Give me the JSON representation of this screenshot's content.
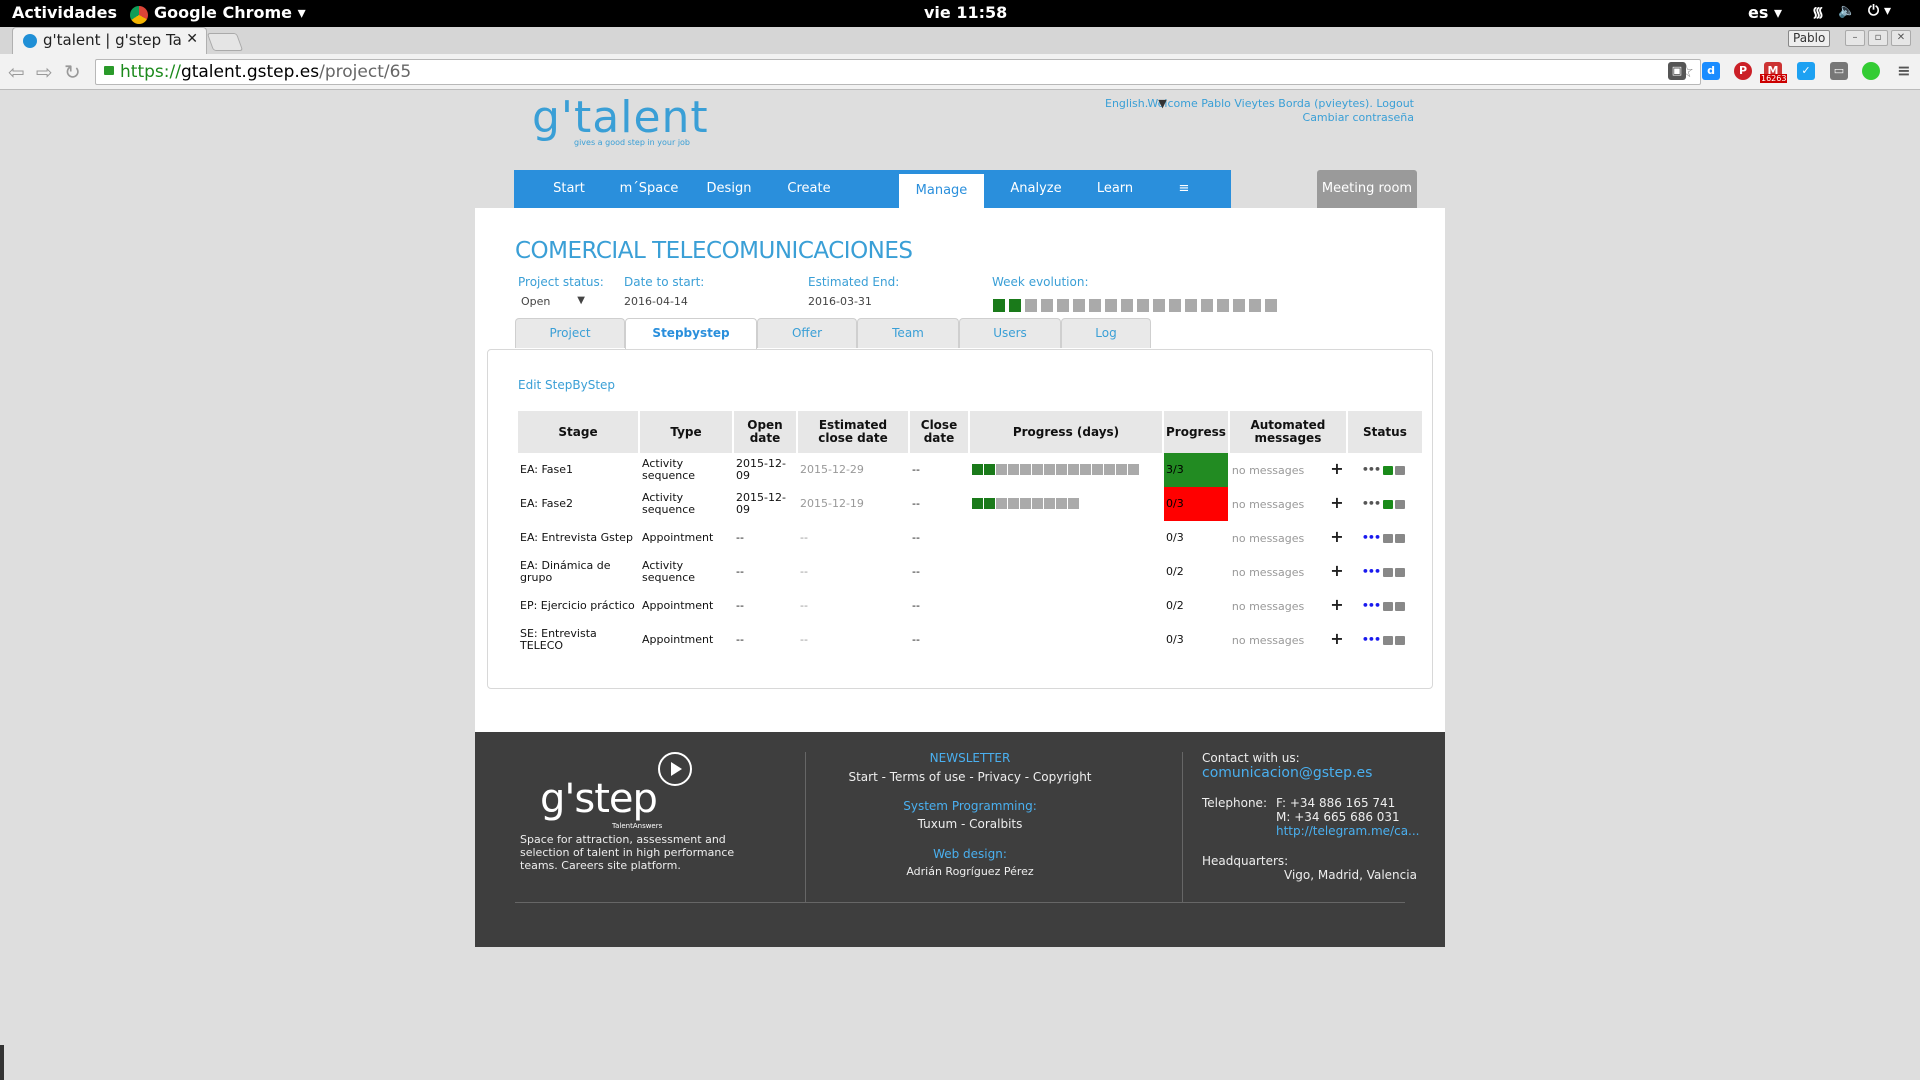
{
  "system": {
    "activities": "Actividades",
    "app_name": "Google Chrome",
    "clock": "vie 11:58",
    "lang": "es"
  },
  "browser": {
    "tab_title": "g'talent | g'step Tale",
    "profile": "Pablo",
    "url_scheme": "https://",
    "url_host": "gtalent.gstep.es",
    "url_path": "/project/65",
    "gmail_badge": "16263"
  },
  "header": {
    "logo_text": "g'talent",
    "logo_tagline": "gives a good step in your job",
    "language": "English.",
    "welcome": "Welcome Pablo Vieytes Borda (pvieytes). Logout",
    "change_password": "Cambiar contraseña"
  },
  "nav": {
    "items": [
      "Start",
      "m´Space",
      "Design",
      "Create",
      "Manage",
      "Analyze",
      "Learn",
      "≡"
    ],
    "active": "Manage",
    "meeting_room": "Meeting room"
  },
  "project": {
    "title": "COMERCIAL TELECOMUNICACIONES",
    "status_label": "Project status:",
    "status_value": "Open",
    "date_start_label": "Date to start:",
    "date_start_value": "2016-04-14",
    "est_end_label": "Estimated End:",
    "est_end_value": "2016-03-31",
    "week_label": "Week evolution:",
    "week_evolution": {
      "green_weeks": 2,
      "total_weeks": 18
    }
  },
  "tabs": [
    "Project",
    "Stepbystep",
    "Offer",
    "Team",
    "Users",
    "Log"
  ],
  "active_tab": "Stepbystep",
  "stepbystep": {
    "edit_link": "Edit StepByStep",
    "headers": [
      "Stage",
      "Type",
      "Open date",
      "Estimated close date",
      "Close date",
      "Progress (days)",
      "Progress",
      "Automated messages",
      "Status"
    ],
    "rows": [
      {
        "stage": "EA: Fase1",
        "type": "Activity sequence",
        "open": "2015-12-09",
        "est_close": "2015-12-29",
        "close": "--",
        "days_green": 2,
        "days_total": 14,
        "progress": "3/3",
        "progress_state": "green",
        "messages": "no messages",
        "status_unlocked": true
      },
      {
        "stage": "EA: Fase2",
        "type": "Activity sequence",
        "open": "2015-12-09",
        "est_close": "2015-12-19",
        "close": "--",
        "days_green": 2,
        "days_total": 9,
        "progress": "0/3",
        "progress_state": "red",
        "messages": "no messages",
        "status_unlocked": true
      },
      {
        "stage": "EA: Entrevista Gstep",
        "type": "Appointment",
        "open": "--",
        "est_close": "--",
        "close": "--",
        "days_green": 0,
        "days_total": 0,
        "progress": "0/3",
        "progress_state": "none",
        "messages": "no messages",
        "status_unlocked": false
      },
      {
        "stage": "EA: Dinámica de grupo",
        "type": "Activity sequence",
        "open": "--",
        "est_close": "--",
        "close": "--",
        "days_green": 0,
        "days_total": 0,
        "progress": "0/2",
        "progress_state": "none",
        "messages": "no messages",
        "status_unlocked": false
      },
      {
        "stage": "EP: Ejercicio práctico",
        "type": "Appointment",
        "open": "--",
        "est_close": "--",
        "close": "--",
        "days_green": 0,
        "days_total": 0,
        "progress": "0/2",
        "progress_state": "none",
        "messages": "no messages",
        "status_unlocked": false
      },
      {
        "stage": "SE: Entrevista TELECO",
        "type": "Appointment",
        "open": "--",
        "est_close": "--",
        "close": "--",
        "days_green": 0,
        "days_total": 0,
        "progress": "0/3",
        "progress_state": "none",
        "messages": "no messages",
        "status_unlocked": false
      }
    ]
  },
  "footer": {
    "logo_text": "g'step",
    "logo_sub": "TalentAnswers",
    "description": "Space for attraction, assessment and selection of talent in high performance teams. Careers site platform.",
    "newsletter": "NEWSLETTER",
    "links": "Start - Terms of use - Privacy - Copyright",
    "sys_prog_label": "System Programming:",
    "sys_prog_value": "Tuxum - Coralbits",
    "web_design_label": "Web design:",
    "web_design_value": "Adrián Rogríguez Pérez",
    "contact_label": "Contact with us:",
    "contact_email": "comunicacion@gstep.es",
    "telephone_label": "Telephone:",
    "phone_f": "F: +34 886 165 741",
    "phone_m": "M: +34 665 686 031",
    "telegram": "http://telegram.me/ca...",
    "hq_label": "Headquarters:",
    "hq_value": "Vigo, Madrid, Valencia"
  },
  "colors": {
    "accent": "#2a8fdc",
    "green": "#1a7a1a",
    "red": "#ff0000",
    "footer_bg": "#3e3e3e"
  }
}
